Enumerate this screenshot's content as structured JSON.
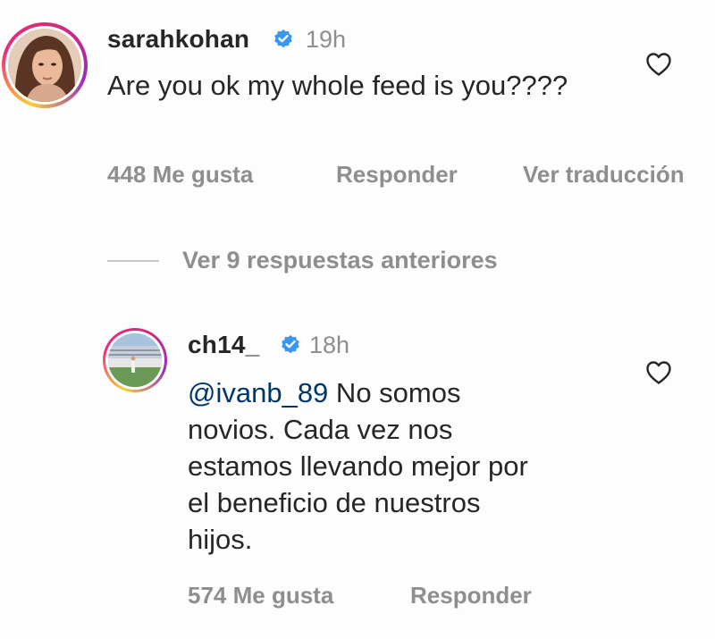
{
  "comment_1": {
    "username": "sarahkohan",
    "time": "19h",
    "text": "Are you ok my whole feed is you????",
    "likes": "448 Me gusta",
    "reply": "Responder",
    "translate": "Ver traducción"
  },
  "view_replies": "Ver 9 respuestas anteriores",
  "comment_2": {
    "username": "ch14_",
    "time": "18h",
    "mention": "@ivanb_89",
    "text": " No somos novios. Cada vez nos estamos llevando mejor por el beneficio de nuestros hijos.",
    "likes": "574 Me gusta",
    "reply": "Responder"
  },
  "icons": {
    "verified": "verified-badge-icon",
    "like": "heart-icon"
  },
  "colors": {
    "verified_blue": "#3897f0",
    "secondary_text": "#8e8e8e",
    "mention": "#00376b"
  }
}
